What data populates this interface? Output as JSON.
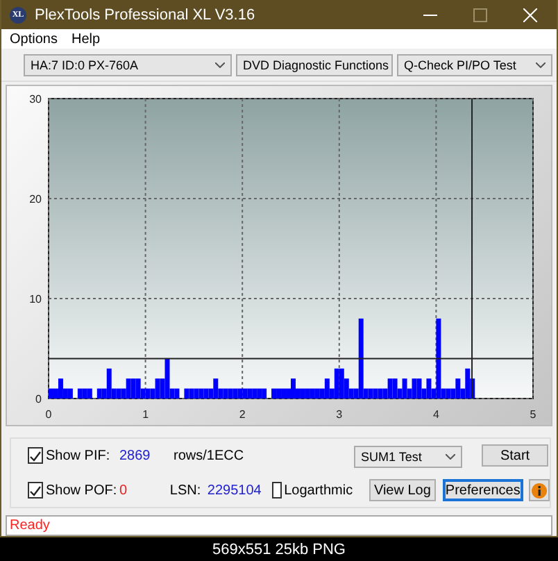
{
  "window": {
    "logo": "XL",
    "title": "PlexTools Professional XL V3.16"
  },
  "menu": [
    "Options",
    "Help"
  ],
  "toolbar": {
    "drive": "HA:7 ID:0  PX-760A",
    "function": "DVD Diagnostic Functions",
    "test": "Q-Check PI/PO Test"
  },
  "chart_data": {
    "type": "bar",
    "xlim": [
      0,
      5
    ],
    "ylim": [
      0,
      30
    ],
    "xticks": [
      0,
      1,
      2,
      3,
      4,
      5
    ],
    "yticks": [
      0,
      10,
      20,
      30
    ],
    "x": [
      0,
      0.05,
      0.1,
      0.15,
      0.2,
      0.25,
      0.3,
      0.35,
      0.4,
      0.45,
      0.5,
      0.55,
      0.6,
      0.65,
      0.7,
      0.75,
      0.8,
      0.85,
      0.9,
      0.95,
      1,
      1.05,
      1.1,
      1.15,
      1.2,
      1.25,
      1.3,
      1.35,
      1.4,
      1.45,
      1.5,
      1.55,
      1.6,
      1.65,
      1.7,
      1.75,
      1.8,
      1.85,
      1.9,
      1.95,
      2,
      2.05,
      2.1,
      2.15,
      2.2,
      2.25,
      2.3,
      2.35,
      2.4,
      2.45,
      2.5,
      2.55,
      2.6,
      2.65,
      2.7,
      2.75,
      2.8,
      2.85,
      2.9,
      2.95,
      3,
      3.05,
      3.1,
      3.15,
      3.2,
      3.25,
      3.3,
      3.35,
      3.4,
      3.45,
      3.5,
      3.55,
      3.6,
      3.65,
      3.7,
      3.75,
      3.8,
      3.85,
      3.9,
      3.95,
      4,
      4.05,
      4.1,
      4.15,
      4.2,
      4.25,
      4.3,
      4.35
    ],
    "series": [
      {
        "color": "#0000ff",
        "values": [
          1,
          1,
          2,
          1,
          1,
          0,
          1,
          1,
          1,
          0,
          1,
          1,
          3,
          1,
          1,
          1,
          2,
          2,
          2,
          1,
          1,
          1,
          2,
          2,
          4,
          1,
          1,
          0,
          1,
          1,
          1,
          1,
          1,
          1,
          2,
          1,
          1,
          1,
          1,
          1,
          1,
          1,
          1,
          1,
          1,
          0,
          1,
          1,
          1,
          1,
          2,
          1,
          1,
          1,
          1,
          1,
          1,
          2,
          1,
          3,
          3,
          2,
          1,
          1,
          8,
          1,
          1,
          1,
          1,
          1,
          2,
          2,
          1,
          2,
          1,
          2,
          2,
          1,
          2,
          1,
          8,
          1,
          1,
          1,
          2,
          1,
          3,
          2
        ]
      }
    ],
    "grid": true,
    "ref_lines": [
      {
        "axis": "y",
        "value": 4
      },
      {
        "axis": "x",
        "value": 4.37
      }
    ]
  },
  "controls": {
    "show_pif": {
      "label": "Show PIF:",
      "checked": true,
      "value": "2869"
    },
    "unit": "rows/1ECC",
    "mode": "SUM1 Test",
    "start": "Start",
    "show_pof": {
      "label": "Show POF:",
      "checked": true,
      "value": "0"
    },
    "lsn_label": "LSN:",
    "lsn": "2295104",
    "logarithmic": {
      "label": "Logarthmic",
      "checked": false
    },
    "view_log": "View Log",
    "preferences": "Preferences"
  },
  "status_bar": "Ready",
  "caption": "569x551 25kb PNG"
}
